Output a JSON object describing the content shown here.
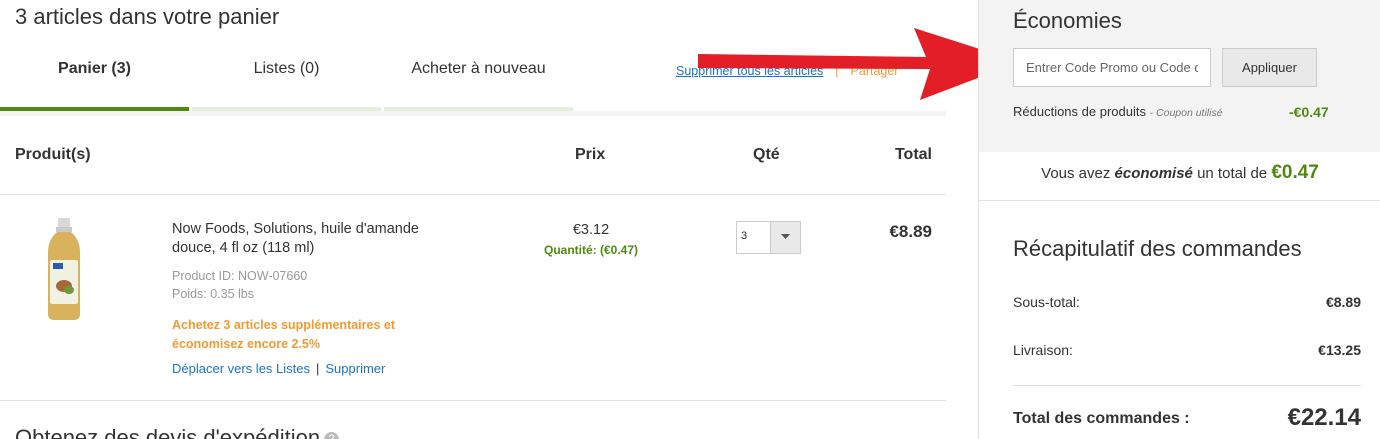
{
  "cart": {
    "heading": "3 articles dans votre panier",
    "tabs": [
      {
        "label": "Panier (3)"
      },
      {
        "label": "Listes (0)"
      },
      {
        "label": "Acheter à nouveau"
      }
    ],
    "remove_all_label": "Supprimer tous les articles",
    "share_label": "Partager",
    "headers": {
      "product": "Produit(s)",
      "price": "Prix",
      "qty": "Qté",
      "total": "Total"
    },
    "items": [
      {
        "name": "Now Foods, Solutions, huile d'amande douce, 4 fl oz (118 ml)",
        "product_id": "Product ID: NOW-07660",
        "weight": "Poids: 0.35 lbs",
        "promo": "Achetez 3 articles supplémentaires et économisez encore 2.5%",
        "move_label": "Déplacer vers les Listes",
        "remove_label": "Supprimer",
        "price": "€3.12",
        "qty_discount": "Quantité: (€0.47)",
        "qty": "3",
        "line_total": "€8.89"
      }
    ],
    "shipping_title": "Obtenez des devis d'expédition",
    "help_icon": "?"
  },
  "sidebar": {
    "savings_title": "Économies",
    "promo_placeholder": "Entrer Code Promo ou Code de Parrainage",
    "apply_label": "Appliquer",
    "reductions_label": "Réductions de produits",
    "coupon_note": "- Coupon utilisé",
    "reductions_value": "-€0.47",
    "saved_prefix": "Vous avez",
    "saved_emph": "économisé",
    "saved_mid": "un total de",
    "saved_amount": "€0.47",
    "summary_title": "Récapitulatif des commandes",
    "subtotal_label": "Sous-total:",
    "subtotal_value": "€8.89",
    "shipping_label": "Livraison:",
    "shipping_value": "€13.25",
    "total_label": "Total des commandes :",
    "total_value": "€22.14"
  },
  "colors": {
    "accent_green": "#4f8a10",
    "link_blue": "#1a73c8",
    "promo_orange": "#f29a30",
    "arrow_red": "#e41e26"
  },
  "icons": {
    "qty_dropdown": "chevron-down-icon",
    "help": "help-icon",
    "annotation": "red-arrow-icon"
  }
}
